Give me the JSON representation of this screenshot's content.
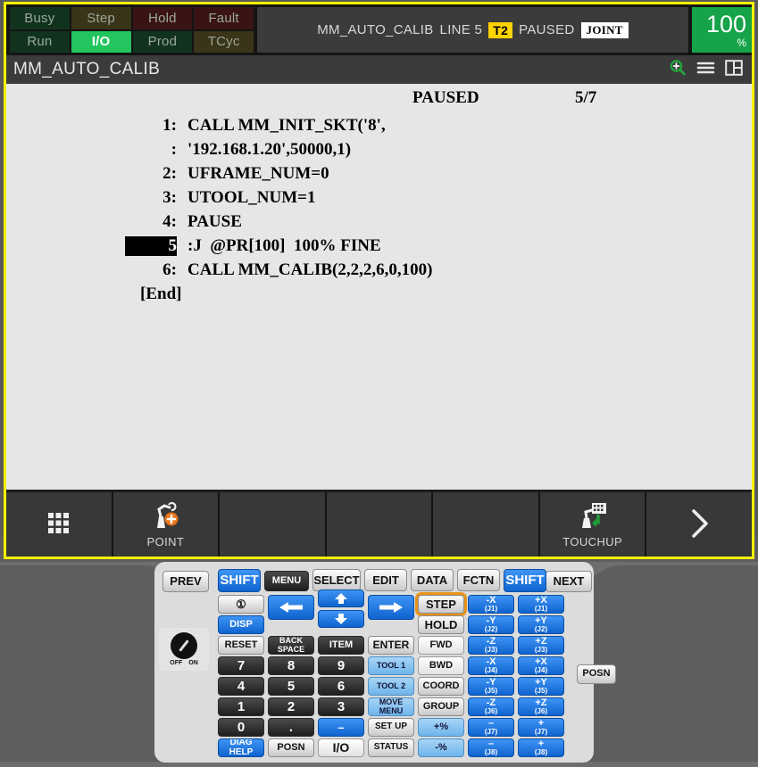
{
  "status_lights": [
    {
      "label": "Busy",
      "state": "off",
      "color": "#11331e"
    },
    {
      "label": "Step",
      "state": "off",
      "color": "#3a3418"
    },
    {
      "label": "Hold",
      "state": "off",
      "color": "#3a1414"
    },
    {
      "label": "Fault",
      "state": "off",
      "color": "#3a1414"
    },
    {
      "label": "Run",
      "state": "off",
      "color": "#11331e"
    },
    {
      "label": "I/O",
      "state": "on",
      "color": "#22c55e"
    },
    {
      "label": "Prod",
      "state": "off",
      "color": "#11331e"
    },
    {
      "label": "TCyc",
      "state": "off",
      "color": "#3a3418"
    }
  ],
  "status_message": {
    "program": "MM_AUTO_CALIB",
    "line": "LINE 5",
    "mode_badge": "T2",
    "state": "PAUSED",
    "frame_badge": "JOINT"
  },
  "override": {
    "value": "100",
    "unit": "%"
  },
  "titlebar": {
    "title": "MM_AUTO_CALIB",
    "icons": [
      "zoom-in-icon",
      "menu-icon",
      "layout-icon"
    ]
  },
  "program": {
    "run_state": "PAUSED",
    "counter": "5/7",
    "lines": [
      {
        "num": "1:",
        "text": "CALL MM_INIT_SKT('8',",
        "selected": false
      },
      {
        "num": ":",
        "text": "'192.168.1.20',50000,1)",
        "selected": false
      },
      {
        "num": "2:",
        "text": "UFRAME_NUM=0",
        "selected": false
      },
      {
        "num": "3:",
        "text": "UTOOL_NUM=1",
        "selected": false
      },
      {
        "num": "4:",
        "text": "PAUSE",
        "selected": false
      },
      {
        "num": "5",
        "text": ":J  @PR[100]  100% FINE",
        "selected": true
      },
      {
        "num": "6:",
        "text": "CALL MM_CALIB(2,2,2,6,0,100)",
        "selected": false
      }
    ],
    "end_marker": "[End]"
  },
  "softkeys": [
    {
      "label": "",
      "icon": "grid-menu-icon"
    },
    {
      "label": "POINT",
      "icon": "robot-add-point-icon"
    },
    {
      "label": "",
      "icon": ""
    },
    {
      "label": "",
      "icon": ""
    },
    {
      "label": "",
      "icon": ""
    },
    {
      "label": "TOUCHUP",
      "icon": "robot-touchup-icon"
    },
    {
      "label": "",
      "icon": "chevron-right-icon"
    }
  ],
  "keypad": {
    "prev": "PREV",
    "next": "NEXT",
    "posn_right": "POSN",
    "knob": {
      "off": "OFF",
      "on": "ON"
    },
    "row_top": [
      {
        "label": "SHIFT",
        "style": "blue"
      },
      {
        "label": "MENU",
        "style": "dark"
      },
      {
        "label": "SELECT",
        "style": "grey"
      },
      {
        "label": "EDIT",
        "style": "grey"
      },
      {
        "label": "DATA",
        "style": "grey"
      },
      {
        "label": "FCTN",
        "style": "grey"
      },
      {
        "label": "SHIFT",
        "style": "blue"
      }
    ],
    "col1": [
      {
        "label": "①",
        "style": "grey",
        "name": "info-key"
      },
      {
        "label": "DISP",
        "style": "blue"
      },
      {
        "label": "RESET",
        "style": "grey"
      },
      {
        "label": "7",
        "style": "dark"
      },
      {
        "label": "4",
        "style": "dark"
      },
      {
        "label": "1",
        "style": "dark"
      },
      {
        "label": "0",
        "style": "dark"
      },
      {
        "label": "DIAG HELP",
        "style": "blue"
      }
    ],
    "col2": [
      {
        "label": "←",
        "style": "arrow"
      },
      {
        "label": "BACK SPACE",
        "style": "dark"
      },
      {
        "label": "8",
        "style": "dark"
      },
      {
        "label": "5",
        "style": "dark"
      },
      {
        "label": "2",
        "style": "dark"
      },
      {
        "label": ".",
        "style": "dark"
      },
      {
        "label": "POSN",
        "style": "grey"
      }
    ],
    "col3": [
      {
        "label": "↑",
        "style": "arrow"
      },
      {
        "label": "↓",
        "style": "arrow"
      },
      {
        "label": "ITEM",
        "style": "dark"
      },
      {
        "label": "9",
        "style": "dark"
      },
      {
        "label": "6",
        "style": "dark"
      },
      {
        "label": "3",
        "style": "dark"
      },
      {
        "label": "–",
        "style": "arrow"
      },
      {
        "label": "I/O",
        "style": "white"
      }
    ],
    "col4": [
      {
        "label": "→",
        "style": "arrow"
      },
      {
        "label": "ENTER",
        "style": "grey"
      },
      {
        "label": "TOOL 1",
        "style": "lblue"
      },
      {
        "label": "TOOL 2",
        "style": "lblue"
      },
      {
        "label": "MOVE MENU",
        "style": "lblue"
      },
      {
        "label": "SET UP",
        "style": "grey"
      },
      {
        "label": "STATUS",
        "style": "grey"
      }
    ],
    "col5": [
      {
        "label": "STEP",
        "style": "grey",
        "selected": true
      },
      {
        "label": "HOLD",
        "style": "grey"
      },
      {
        "label": "FWD",
        "style": "white"
      },
      {
        "label": "BWD",
        "style": "white"
      },
      {
        "label": "COORD",
        "style": "grey"
      },
      {
        "label": "GROUP",
        "style": "grey"
      },
      {
        "label": "+%",
        "style": "lblue"
      },
      {
        "label": "-%",
        "style": "lblue"
      }
    ],
    "jog_minus": [
      {
        "axis": "-X",
        "joint": "(J1)"
      },
      {
        "axis": "-Y",
        "joint": "(J2)"
      },
      {
        "axis": "-Z",
        "joint": "(J3)"
      },
      {
        "axis": "-X",
        "joint": "(J4)"
      },
      {
        "axis": "-Y",
        "joint": "(J5)"
      },
      {
        "axis": "-Z",
        "joint": "(J6)"
      },
      {
        "axis": "–",
        "joint": "(J7)"
      },
      {
        "axis": "–",
        "joint": "(J8)"
      }
    ],
    "jog_plus": [
      {
        "axis": "+X",
        "joint": "(J1)"
      },
      {
        "axis": "+Y",
        "joint": "(J2)"
      },
      {
        "axis": "+Z",
        "joint": "(J3)"
      },
      {
        "axis": "+X",
        "joint": "(J4)"
      },
      {
        "axis": "+Y",
        "joint": "(J5)"
      },
      {
        "axis": "+Z",
        "joint": "(J6)"
      },
      {
        "axis": "+",
        "joint": "(J7)"
      },
      {
        "axis": "+",
        "joint": "(J8)"
      }
    ]
  },
  "colors": {
    "bezel": "#f5f000",
    "accent_green": "#16a34a",
    "mode_badge": "#ffd400",
    "selection": "#000000",
    "select_ring": "#e8941a"
  }
}
